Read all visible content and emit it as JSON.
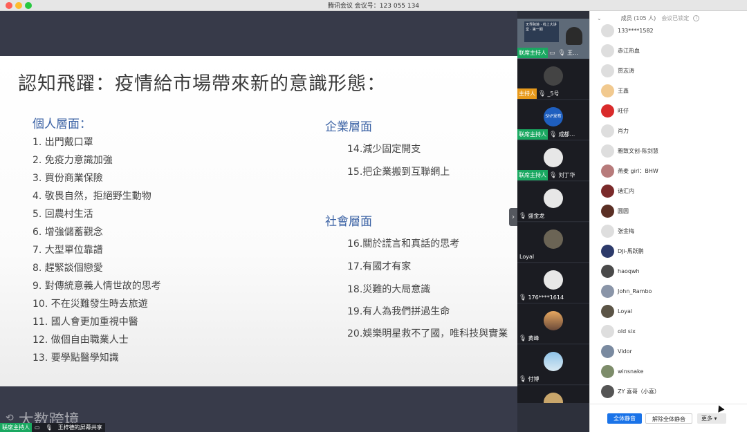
{
  "window": {
    "title": "腾讯会议 会议号：123 055 134"
  },
  "slide": {
    "title": "認知飛躍：疫情給市場帶來新的意識形態：",
    "personal": {
      "heading": "個人層面：",
      "items": [
        "1.   出門戴口罩",
        "2.   免疫力意識加強",
        "3.   買份商業保險",
        "4.   敬畏自然，拒絕野生動物",
        "5.   回農村生活",
        "6.   增強儲蓄觀念",
        "7.   大型單位靠譜",
        "8.   趕緊談個戀愛",
        "9.   對傳統意義人情世故的思考",
        "10. 不在災難發生時去旅遊",
        "11.  國人會更加重視中醫",
        "12.  做個自由職業人士",
        "13.  要學點醫學知識"
      ]
    },
    "enterprise": {
      "heading": "企業層面",
      "items": [
        "14.減少固定開支",
        "15.把企業搬到互聯網上"
      ]
    },
    "society": {
      "heading": "社會層面",
      "items": [
        "16.關於謊言和真話的思考",
        "17.有國才有家",
        "18.災難的大局意識",
        "19.有人為我們拼過生命",
        "20.娛樂明星救不了國，唯科技與實業"
      ]
    }
  },
  "share_bar": {
    "host_badge": "联席主持人",
    "text": "王梓德的屏幕共享",
    "watermark": "大数跨境"
  },
  "gallery": {
    "collapse_icon": "chevron-right-icon",
    "tiles": [
      {
        "role": "联席主持人",
        "name": "王…",
        "banner": "无界跨境 · 线上大讲堂 · 第一期"
      },
      {
        "role": "主持人",
        "name": "_5号"
      },
      {
        "role": "联席主持人",
        "name": "成都…",
        "avatar_text": "ShP发布"
      },
      {
        "role": "联席主持人",
        "name": "刘丁华"
      },
      {
        "role": "",
        "name": "盛金龙"
      },
      {
        "role": "",
        "name": "Loyal"
      },
      {
        "role": "",
        "name": "176****1614"
      },
      {
        "role": "",
        "name": "黄峰"
      },
      {
        "role": "",
        "name": "付博"
      }
    ]
  },
  "panel": {
    "members_label": "成员 (105 人)",
    "locked_label": "会议已锁定",
    "info_icon": "i",
    "members": [
      "133****1582",
      "赤江热血",
      "贾志涛",
      "王鑫",
      "旺仔",
      "肖力",
      "雅致文创-陈剑慧",
      "燕麦 girl：BHW",
      "谐汇内",
      "圆圆",
      "张金梅",
      "DJi-馬跃鹏",
      "haoqwh",
      "John_Rambo",
      "Loyal",
      "old six",
      "Vidor",
      "winsnake",
      "ZY 喜哥（小喜）"
    ],
    "buttons": {
      "mute_all": "全体静音",
      "unmute_all": "解除全体静音",
      "more": "更多 ▾"
    }
  }
}
